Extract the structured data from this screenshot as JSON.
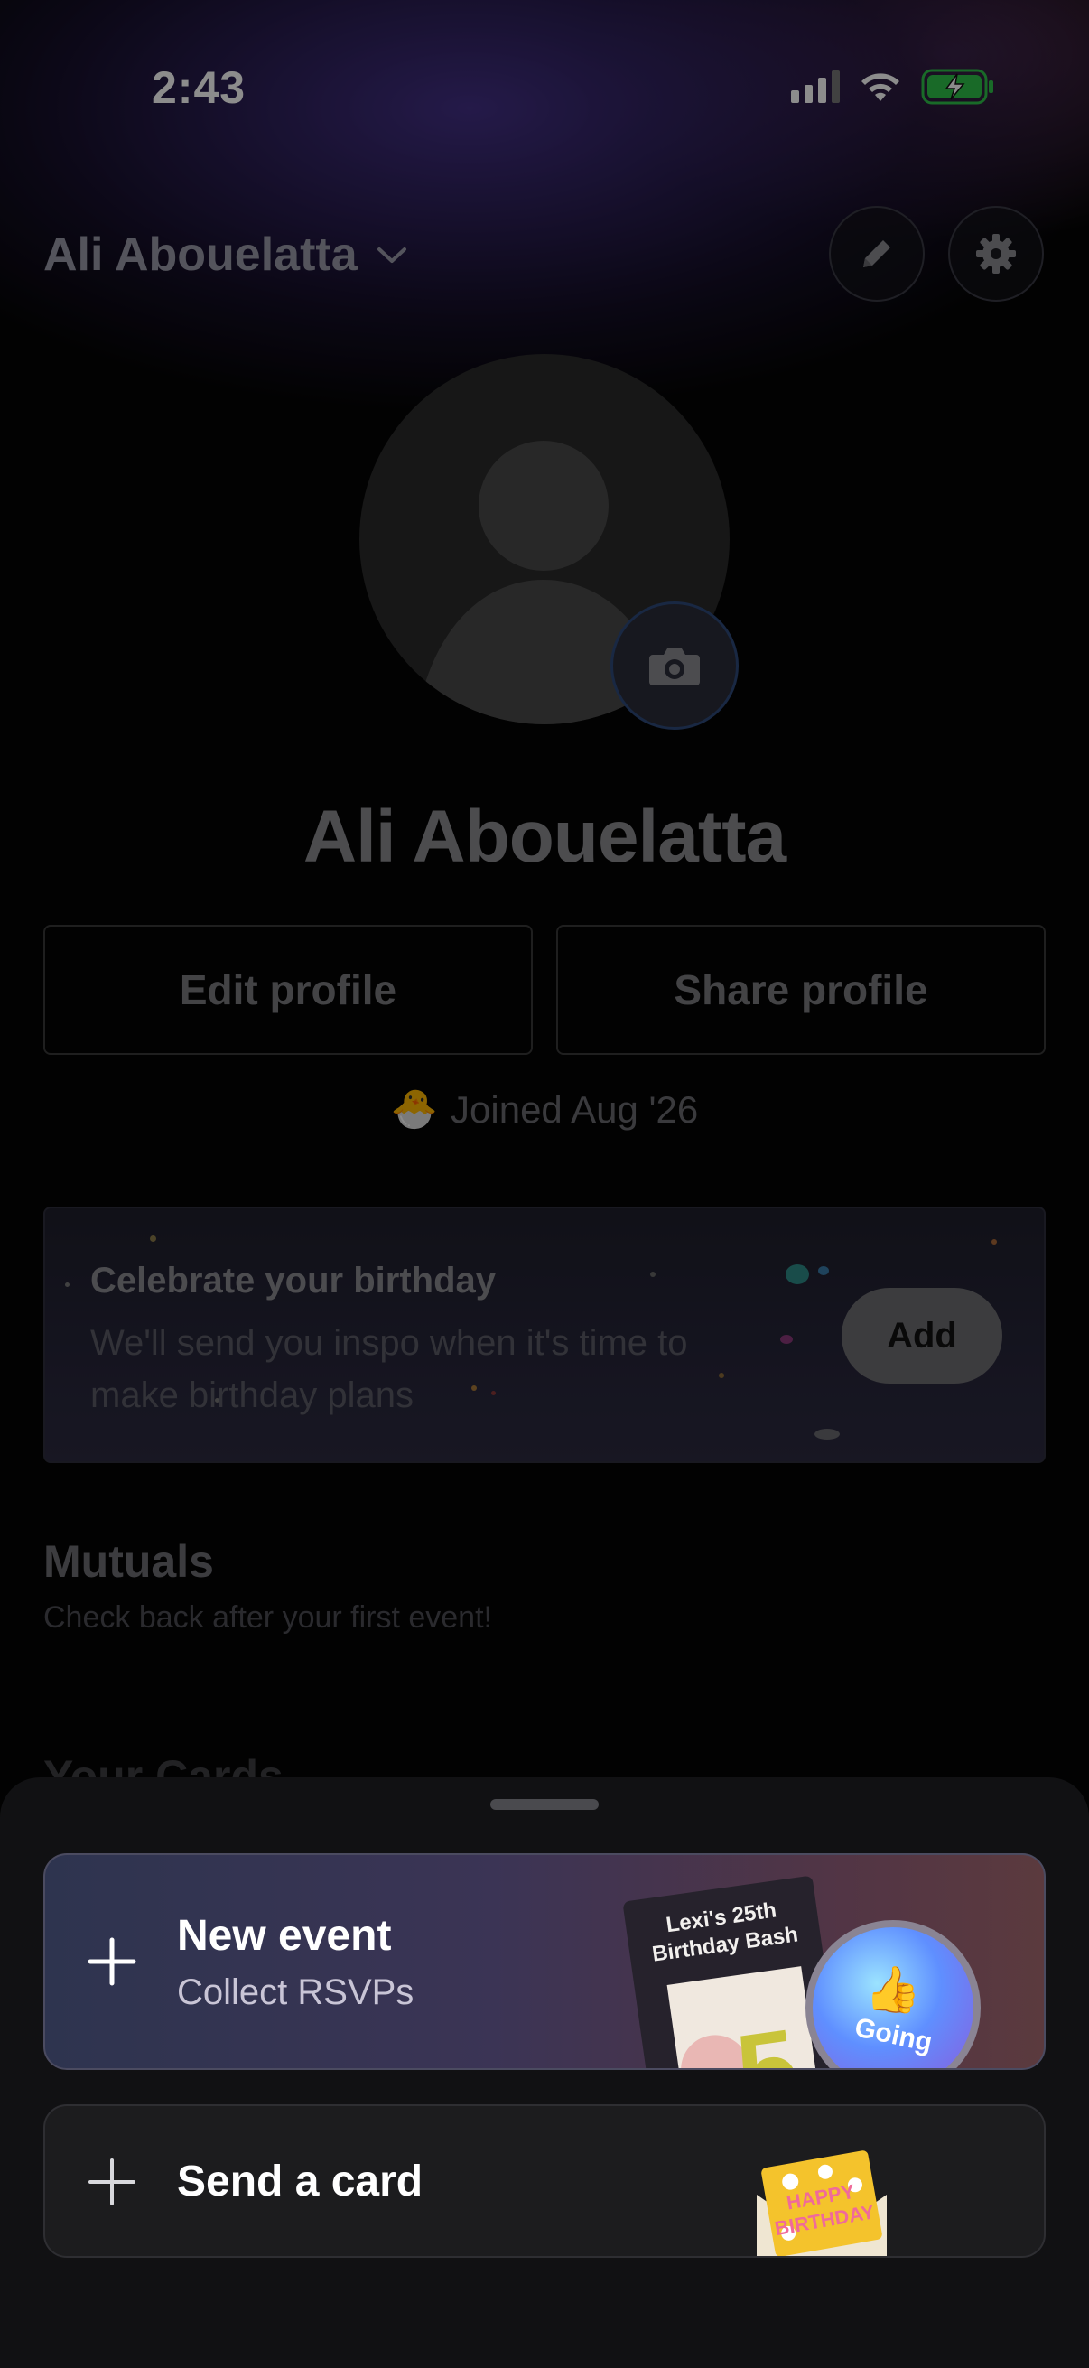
{
  "status_bar": {
    "time": "2:43",
    "icons": [
      "signal-icon",
      "wifi-icon",
      "battery-charging-icon"
    ]
  },
  "header": {
    "account_name": "Ali Abouelatta",
    "account_switch_icon": "chevron-down-icon",
    "edit_icon": "pencil-icon",
    "settings_icon": "gear-icon"
  },
  "profile": {
    "name": "Ali Abouelatta",
    "avatar_icon": "person-placeholder-icon",
    "camera_icon": "camera-icon",
    "edit_profile_label": "Edit profile",
    "share_profile_label": "Share profile",
    "joined_text": "Joined Aug '26",
    "joined_emoji": "🐣"
  },
  "birthday_card": {
    "title": "Celebrate your birthday",
    "subtitle": "We'll send you inspo when it's time to make birthday plans",
    "add_label": "Add"
  },
  "mutuals": {
    "title": "Mutuals",
    "subtitle": "Check back after your first event!"
  },
  "cards_section": {
    "title_partial": "Your Cards"
  },
  "sheet": {
    "new_event": {
      "title": "New event",
      "subtitle": "Collect RSVPs",
      "poster_text": "Lexi's 25th Birthday Bash",
      "going_label": "Going",
      "going_emoji": "👍"
    },
    "send_card": {
      "title": "Send a card",
      "envelope_text": "HAPPY BIRTHDAY"
    }
  },
  "colors": {
    "background": "#050505",
    "accent_gradient_start": "#2e344f",
    "accent_gradient_end": "#5b3a3e",
    "add_button": "#6e6e72"
  }
}
